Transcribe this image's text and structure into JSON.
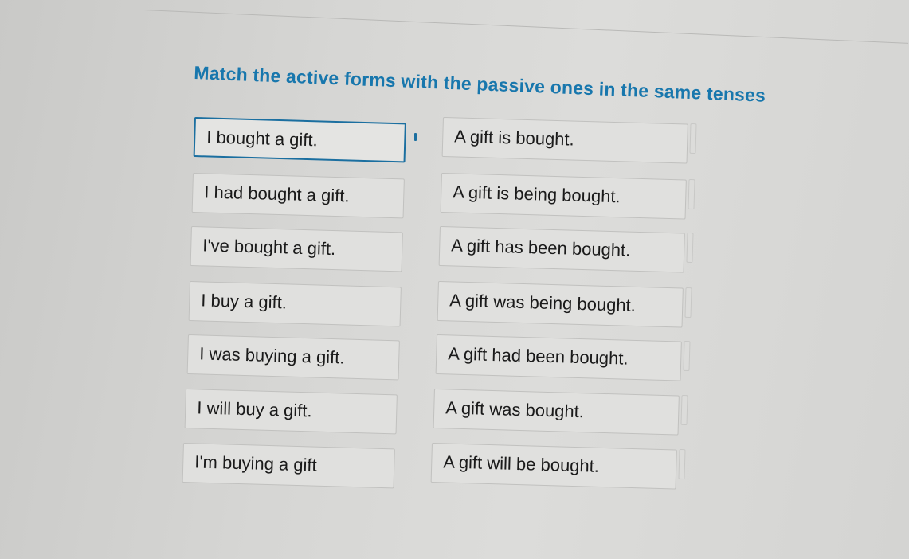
{
  "instruction": "Match the active forms with the passive ones in the same tenses",
  "pairs": [
    {
      "active": "I bought a gift.",
      "passive": "A gift is bought."
    },
    {
      "active": "I had bought a gift.",
      "passive": "A gift is being bought."
    },
    {
      "active": "I've bought a gift.",
      "passive": "A gift has been bought."
    },
    {
      "active": "I buy a gift.",
      "passive": "A gift was being bought."
    },
    {
      "active": "I was buying a gift.",
      "passive": "A gift had been bought."
    },
    {
      "active": "I will buy a gift.",
      "passive": "A gift was bought."
    },
    {
      "active": "I'm buying a gift",
      "passive": "A gift will be bought."
    }
  ],
  "colors": {
    "title": "#1877ad",
    "selected_border": "#1b6fa0"
  }
}
